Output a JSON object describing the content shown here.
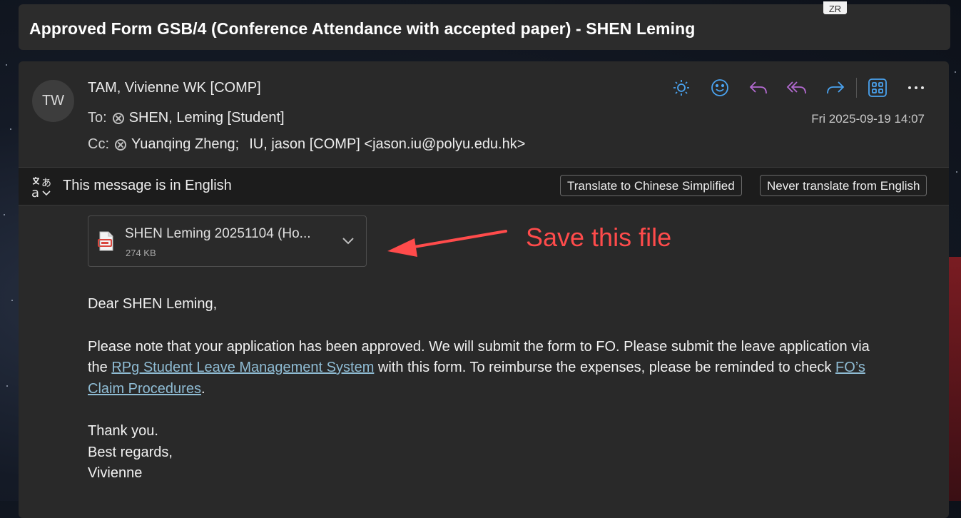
{
  "subject": "Approved Form GSB/4 (Conference Attendance with accepted paper) - SHEN Leming",
  "badge": "ZR",
  "sender": {
    "initials": "TW",
    "name": "TAM, Vivienne WK [COMP]"
  },
  "to": {
    "label": "To:",
    "recipient": "SHEN, Leming [Student]"
  },
  "cc": {
    "label": "Cc:",
    "recipient1": "Yuanqing Zheng;",
    "recipient2": "IU, jason [COMP] <jason.iu@polyu.edu.hk>"
  },
  "date": "Fri 2025-09-19 14:07",
  "toolbar": {
    "icons": [
      "sun-icon",
      "emoji-icon",
      "reply-icon",
      "reply-all-icon",
      "forward-icon",
      "apps-icon",
      "more-icon"
    ],
    "accent_colors": {
      "blue": "#4aa3f0",
      "purple": "#b36ad1"
    }
  },
  "translation": {
    "message": "This message is in English",
    "translate_btn": "Translate to Chinese Simplified",
    "never_btn": "Never translate from English"
  },
  "attachment": {
    "name": "SHEN Leming 20251104 (Ho...",
    "size": "274 KB"
  },
  "annotation": {
    "text": "Save this file",
    "color": "#ff4b4b"
  },
  "body": {
    "greeting": "Dear SHEN Leming,",
    "p1_a": "Please note that your application has been approved. We will submit the form to FO. Please submit the leave application via the ",
    "link1": "RPg Student Leave Management System",
    "p1_b": " with this form. To reimburse the expenses, please be reminded to check ",
    "link2": "FO’s Claim Procedures",
    "p1_c": ".",
    "thanks": "Thank you.",
    "regards": "Best regards,",
    "signoff": "Vivienne"
  }
}
